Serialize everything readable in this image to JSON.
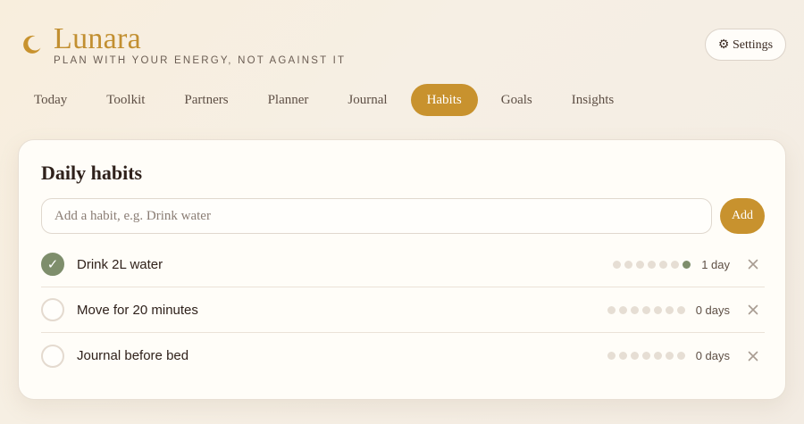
{
  "brand": {
    "name": "Lunara",
    "tagline": "PLAN WITH YOUR ENERGY, NOT AGAINST IT",
    "logo_icon": "crescent-moon-icon",
    "accent_color": "#c8922e"
  },
  "header": {
    "settings_label": "⚙ Settings"
  },
  "nav": {
    "tabs": [
      {
        "label": "Today",
        "active": false
      },
      {
        "label": "Toolkit",
        "active": false
      },
      {
        "label": "Partners",
        "active": false
      },
      {
        "label": "Planner",
        "active": false
      },
      {
        "label": "Journal",
        "active": false
      },
      {
        "label": "Habits",
        "active": true
      },
      {
        "label": "Goals",
        "active": false
      },
      {
        "label": "Insights",
        "active": false
      }
    ]
  },
  "habits": {
    "title": "Daily habits",
    "input": {
      "value": "",
      "placeholder": "Add a habit, e.g. Drink water"
    },
    "add_label": "Add",
    "items": [
      {
        "name": "Drink 2L water",
        "done": true,
        "week": [
          false,
          false,
          false,
          false,
          false,
          false,
          true
        ],
        "streak": "1 day"
      },
      {
        "name": "Move for 20 minutes",
        "done": false,
        "week": [
          false,
          false,
          false,
          false,
          false,
          false,
          false
        ],
        "streak": "0 days"
      },
      {
        "name": "Journal before bed",
        "done": false,
        "week": [
          false,
          false,
          false,
          false,
          false,
          false,
          false
        ],
        "streak": "0 days"
      }
    ],
    "done_color": "#7e8e6c"
  }
}
